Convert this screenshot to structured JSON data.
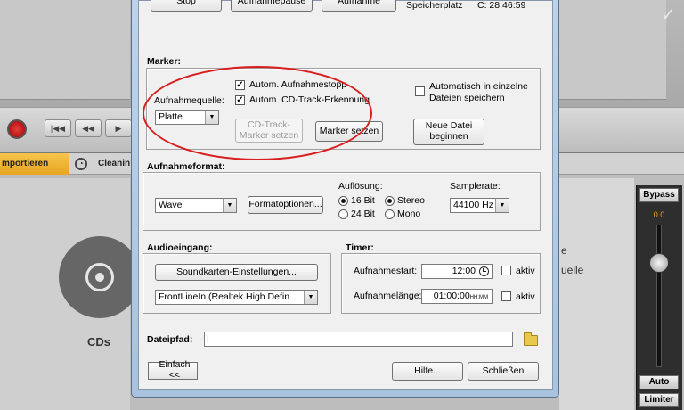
{
  "background": {
    "import_tab": "mportieren",
    "cleaning_tab": "Cleanin",
    "cds_label": "CDs",
    "right_snippet_1": "e",
    "right_snippet_2": "uelle",
    "bypass_label": "Bypass",
    "level_value": "0.0",
    "auto_label": "Auto",
    "limiter_label": "Limiter"
  },
  "dialog": {
    "top_buttons": {
      "stop": "Stop",
      "pause": "Aufnahmepause",
      "record": "Aufnahme"
    },
    "storage": {
      "label": "Speicherplatz",
      "value": "C: 28:46:59"
    },
    "marker": {
      "title": "Marker:",
      "source_label": "Aufnahmequelle:",
      "source_value": "Platte",
      "auto_stop": "Autom. Aufnahmestopp",
      "cd_track_detect": "Autom. CD-Track-Erkennung",
      "cd_track_marker_btn_1": "CD-Track-",
      "cd_track_marker_btn_2": "Marker setzen",
      "set_marker_btn": "Marker setzen",
      "auto_split_1": "Automatisch in einzelne",
      "auto_split_2": "Dateien speichern",
      "new_file_btn_1": "Neue Datei",
      "new_file_btn_2": "beginnen"
    },
    "format": {
      "title": "Aufnahmeformat:",
      "format_value": "Wave",
      "options_btn": "Formatoptionen...",
      "resolution_label": "Auflösung:",
      "bit16": "16 Bit",
      "bit24": "24 Bit",
      "stereo": "Stereo",
      "mono": "Mono",
      "samplerate_label": "Samplerate:",
      "samplerate_value": "44100 Hz"
    },
    "audio_input": {
      "title": "Audioeingang:",
      "soundcard_btn": "Soundkarten-Einstellungen...",
      "device_value": "FrontLineIn (Realtek High Defin"
    },
    "timer": {
      "title": "Timer:",
      "start_label": "Aufnahmestart:",
      "start_value": "12:00",
      "length_label": "Aufnahmelänge:",
      "length_value": "01:00:00",
      "length_unit": "HH:MM",
      "active_1": "aktiv",
      "active_2": "aktiv"
    },
    "path": {
      "label": "Dateipfad:",
      "value": "|"
    },
    "bottom": {
      "simple_btn": "Einfach <<",
      "help_btn": "Hilfe...",
      "close_btn": "Schließen"
    }
  }
}
